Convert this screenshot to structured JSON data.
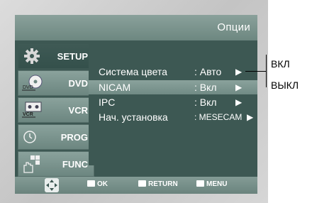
{
  "osd": {
    "title": "Опции"
  },
  "tabs": [
    {
      "label": "SETUP",
      "icon": "gear-icon",
      "active": true
    },
    {
      "label": "DVD",
      "icon": "dvd-disc-icon",
      "active": false,
      "icon_text": "DVD"
    },
    {
      "label": "VCR",
      "icon": "vcr-icon",
      "active": false,
      "icon_text": "VCR"
    },
    {
      "label": "PROG",
      "icon": "clock-icon",
      "active": false
    },
    {
      "label": "FUNC",
      "icon": "remote-hand-icon",
      "active": false
    }
  ],
  "menu": [
    {
      "name": "Система цвета",
      "value": ": Авто",
      "arrow": "▶",
      "selected": false
    },
    {
      "name": "NICAM",
      "value": ": Вкл",
      "arrow": "▶",
      "selected": true
    },
    {
      "name": "IPC",
      "value": ": Вкл",
      "arrow": "▶",
      "selected": false
    },
    {
      "name": "Нач. установка",
      "value": ": MESECAM",
      "arrow": "▶",
      "selected": false
    }
  ],
  "footer": {
    "ok": "OK",
    "return": "RETURN",
    "menu": "MENU"
  },
  "callout": {
    "options": [
      "ВКЛ",
      "ВЫКЛ"
    ]
  },
  "colors": {
    "osd_bg": "#3d5853",
    "highlight": "#8aa29c"
  }
}
